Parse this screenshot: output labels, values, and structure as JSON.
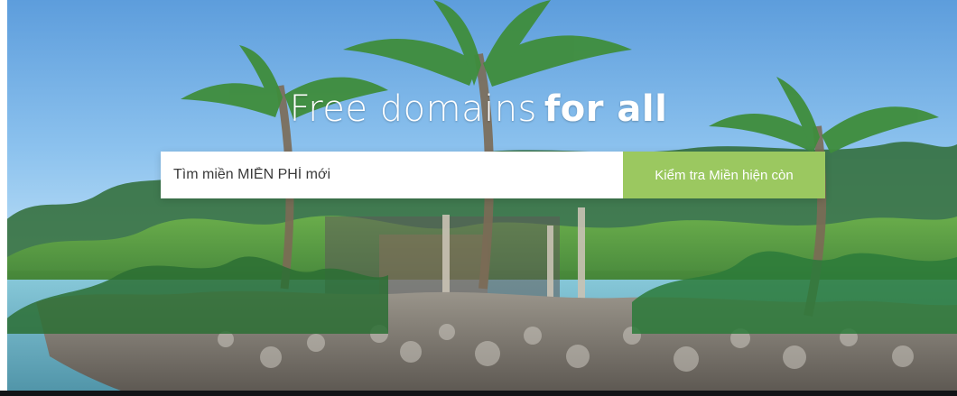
{
  "hero": {
    "title_light": "Free domains",
    "title_bold": "for all"
  },
  "search": {
    "placeholder": "Tìm miền MIỄN PHÍ mới",
    "value": ""
  },
  "actions": {
    "check_button_label": "Kiểm tra Miền hiện còn"
  }
}
